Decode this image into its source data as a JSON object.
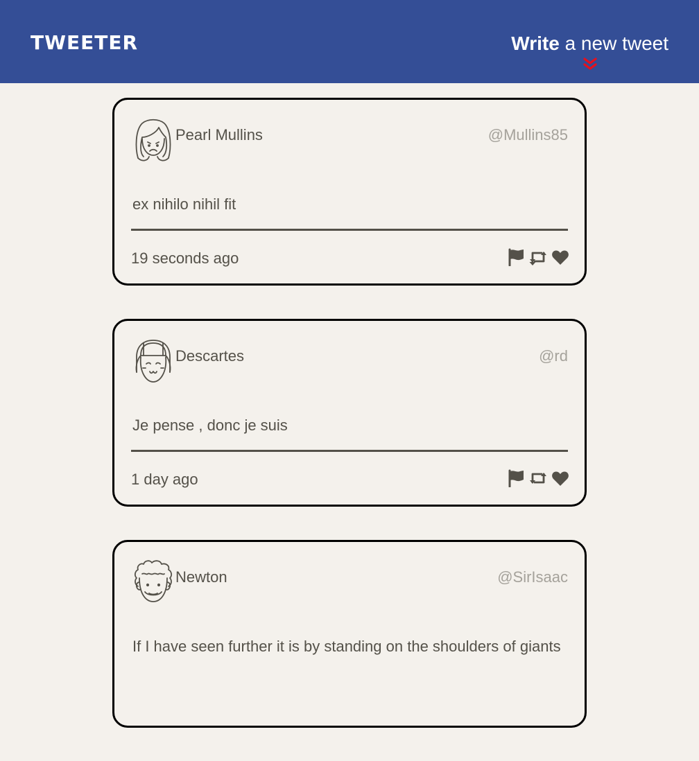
{
  "nav": {
    "brand": "TWEETER",
    "compose_bold": "Write",
    "compose_rest": " a new tweet"
  },
  "colors": {
    "navbar": "#344e96",
    "background": "#f4f1ec",
    "text": "#545149",
    "handle": "#a5a29b",
    "chevron": "#e8101c"
  },
  "tweets": [
    {
      "name": "Pearl Mullins",
      "handle": "@Mullins85",
      "content": "ex nihilo nihil fit",
      "time": "19 seconds ago",
      "avatar_icon": "woman-sad-avatar-icon"
    },
    {
      "name": "Descartes",
      "handle": "@rd",
      "content": "Je pense , donc je suis",
      "time": "1 day ago",
      "avatar_icon": "girl-smiling-avatar-icon"
    },
    {
      "name": "Newton",
      "handle": "@SirIsaac",
      "content": "If I have seen further it is by standing on the shoulders of giants",
      "time": "",
      "avatar_icon": "curly-hair-man-avatar-icon"
    }
  ],
  "action_icons": [
    "flag-icon",
    "retweet-icon",
    "heart-icon"
  ]
}
